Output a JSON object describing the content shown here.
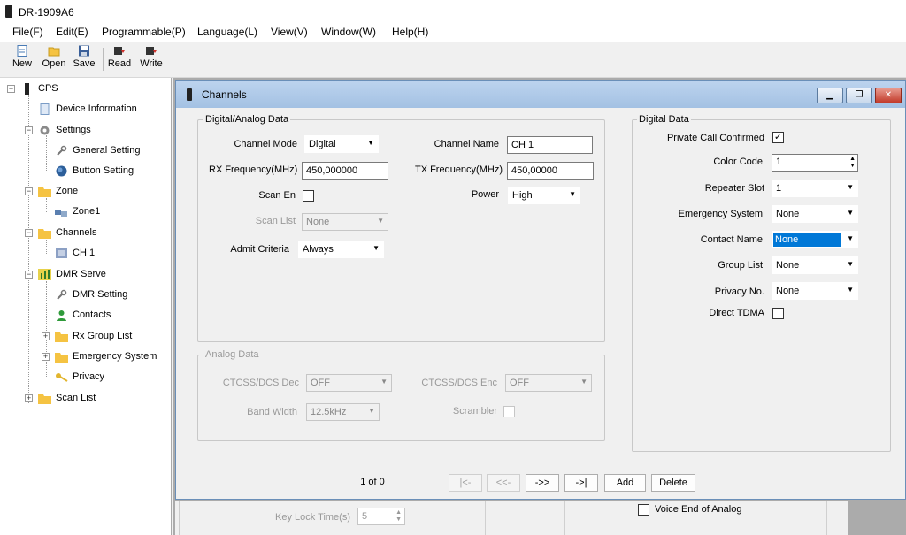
{
  "app": {
    "title": "DR-1909A6"
  },
  "menu": [
    "File(F)",
    "Edit(E)",
    "Programmable(P)",
    "Language(L)",
    "View(V)",
    "Window(W)",
    "Help(H)"
  ],
  "toolbar": {
    "new": "New",
    "open": "Open",
    "save": "Save",
    "read": "Read",
    "write": "Write"
  },
  "tree": {
    "cps": "CPS",
    "device_information": "Device Information",
    "settings": "Settings",
    "general_setting": "General Setting",
    "button_setting": "Button Setting",
    "zone": "Zone",
    "zone1": "Zone1",
    "channels": "Channels",
    "ch1": "CH 1",
    "dmr_serve": "DMR Serve",
    "dmr_setting": "DMR Setting",
    "contacts": "Contacts",
    "rx_group_list": "Rx Group List",
    "emergency_system": "Emergency System",
    "privacy": "Privacy",
    "scan_list": "Scan List"
  },
  "window": {
    "title": "Channels"
  },
  "digital_analog": {
    "group_title": "Digital/Analog Data",
    "channel_mode_label": "Channel Mode",
    "channel_mode_value": "Digital",
    "channel_name_label": "Channel Name",
    "channel_name_value": "CH 1",
    "rx_freq_label": "RX Frequency(MHz)",
    "rx_freq_value": "450,000000",
    "tx_freq_label": "TX Frequency(MHz)",
    "tx_freq_value": "450,00000",
    "scan_en_label": "Scan En",
    "power_label": "Power",
    "power_value": "High",
    "scan_list_label": "Scan List",
    "scan_list_value": "None",
    "admit_criteria_label": "Admit Criteria",
    "admit_criteria_value": "Always"
  },
  "analog": {
    "group_title": "Analog Data",
    "ctcss_dec_label": "CTCSS/DCS Dec",
    "ctcss_dec_value": "OFF",
    "ctcss_enc_label": "CTCSS/DCS Enc",
    "ctcss_enc_value": "OFF",
    "bandwidth_label": "Band Width",
    "bandwidth_value": "12.5kHz",
    "scrambler_label": "Scrambler"
  },
  "digital": {
    "group_title": "Digital Data",
    "private_call_label": "Private Call Confirmed",
    "private_call_checked": "✓",
    "color_code_label": "Color Code",
    "color_code_value": "1",
    "repeater_slot_label": "Repeater Slot",
    "repeater_slot_value": "1",
    "emergency_system_label": "Emergency System",
    "emergency_system_value": "None",
    "contact_name_label": "Contact Name",
    "contact_name_value": "None",
    "group_list_label": "Group List",
    "group_list_value": "None",
    "privacy_no_label": "Privacy No.",
    "privacy_no_value": "None",
    "direct_tdma_label": "Direct TDMA"
  },
  "nav": {
    "page": "1 of 0",
    "first": "|<-",
    "prev": "<<-",
    "next": "->>",
    "last": "->|",
    "add": "Add",
    "delete": "Delete"
  },
  "background_pane": {
    "key_lock_label": "Key Lock Time(s)",
    "key_lock_value": "5",
    "voice_end_label": "Voice End of Analog"
  },
  "colors": {
    "accent": "#0078d7",
    "titlebar": "#bcd3ee",
    "folder": "#f5c342"
  }
}
